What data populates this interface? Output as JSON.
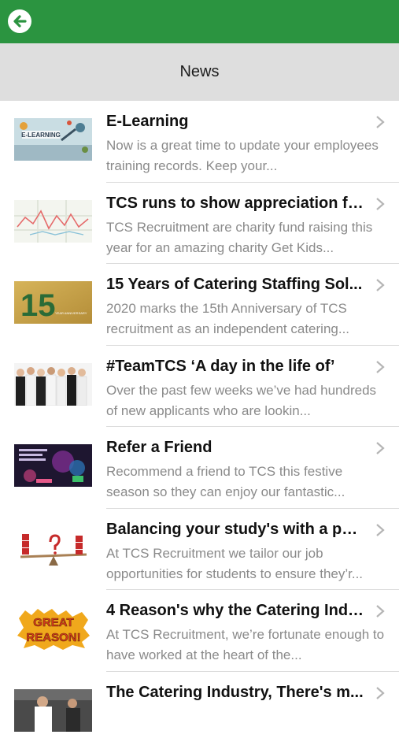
{
  "header": {
    "back_icon": "back-arrow-icon",
    "brand_color": "#2b9440"
  },
  "subheader": {
    "title": "News"
  },
  "news": [
    {
      "title": "E-Learning",
      "description": "Now is a great time to update your employees training records. Keep your...",
      "thumb_text": "E-LEARNING"
    },
    {
      "title": "TCS runs to show appreciation fo...",
      "description": "TCS Recruitment are charity fund raising this year for an amazing charity Get Kids..."
    },
    {
      "title": "15 Years of Catering Staffing Sol...",
      "description": "2020 marks the 15th Anniversary of TCS recruitment as an independent catering...",
      "thumb_text": "15",
      "thumb_subtext": "YEAR ANNIVERSARY"
    },
    {
      "title": "#TeamTCS ‘A day in the life of’",
      "description": "Over the past few weeks we’ve had hundreds of new applicants who are lookin..."
    },
    {
      "title": "Refer a Friend",
      "description": "Recommend a friend to TCS this festive season so they can enjoy our fantastic..."
    },
    {
      "title": "Balancing your study's with a par...",
      "description": "At TCS Recruitment we tailor our job opportunities for students to ensure they’r..."
    },
    {
      "title": "4 Reason's why the Catering Indu...",
      "description": "At TCS Recruitment, we’re fortunate enough to have worked at the heart of the...",
      "thumb_text": "GREAT",
      "thumb_subtext": "REASON!"
    },
    {
      "title": "The Catering Industry, There's m...",
      "description": ""
    }
  ]
}
